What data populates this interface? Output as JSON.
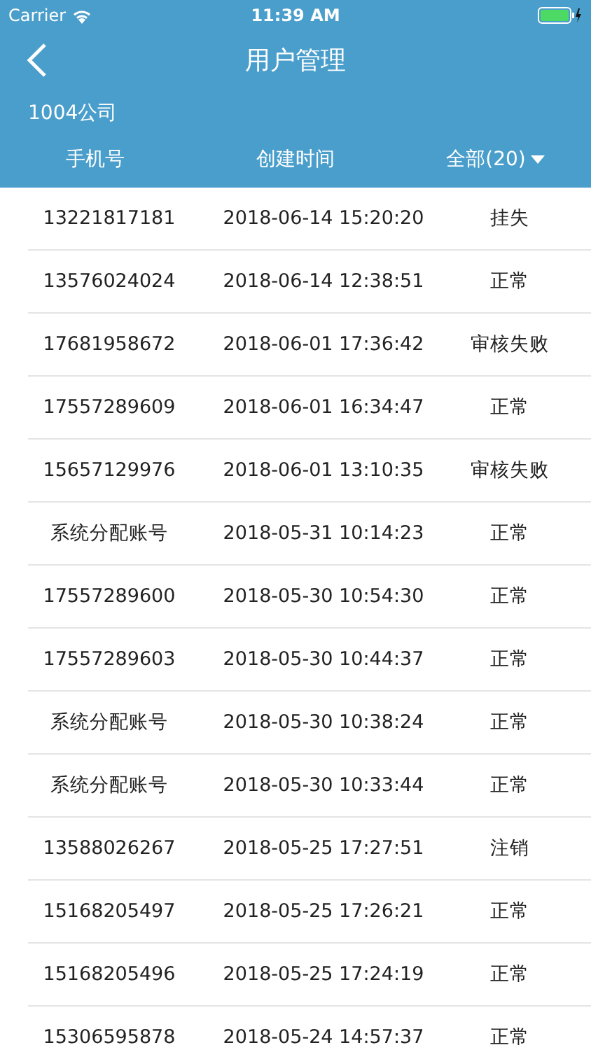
{
  "status_bar": {
    "carrier": "Carrier",
    "time": "11:39 AM"
  },
  "nav": {
    "title": "用户管理"
  },
  "company": "1004公司",
  "columns": [
    {
      "label": "手机号",
      "kind": "plain"
    },
    {
      "label": "创建时间",
      "kind": "plain"
    },
    {
      "label": "全部(20)",
      "kind": "dropdown"
    }
  ],
  "rows": [
    {
      "phone": "13221817181",
      "created": "2018-06-14 15:20:20",
      "status": "挂失"
    },
    {
      "phone": "13576024024",
      "created": "2018-06-14 12:38:51",
      "status": "正常"
    },
    {
      "phone": "17681958672",
      "created": "2018-06-01 17:36:42",
      "status": "审核失败"
    },
    {
      "phone": "17557289609",
      "created": "2018-06-01 16:34:47",
      "status": "正常"
    },
    {
      "phone": "15657129976",
      "created": "2018-06-01 13:10:35",
      "status": "审核失败"
    },
    {
      "phone": "系统分配账号",
      "created": "2018-05-31 10:14:23",
      "status": "正常"
    },
    {
      "phone": "17557289600",
      "created": "2018-05-30 10:54:30",
      "status": "正常"
    },
    {
      "phone": "17557289603",
      "created": "2018-05-30 10:44:37",
      "status": "正常"
    },
    {
      "phone": "系统分配账号",
      "created": "2018-05-30 10:38:24",
      "status": "正常"
    },
    {
      "phone": "系统分配账号",
      "created": "2018-05-30 10:33:44",
      "status": "正常"
    },
    {
      "phone": "13588026267",
      "created": "2018-05-25 17:27:51",
      "status": "注销"
    },
    {
      "phone": "15168205497",
      "created": "2018-05-25 17:26:21",
      "status": "正常"
    },
    {
      "phone": "15168205496",
      "created": "2018-05-25 17:24:19",
      "status": "正常"
    },
    {
      "phone": "15306595878",
      "created": "2018-05-24 14:57:37",
      "status": "正常"
    }
  ]
}
